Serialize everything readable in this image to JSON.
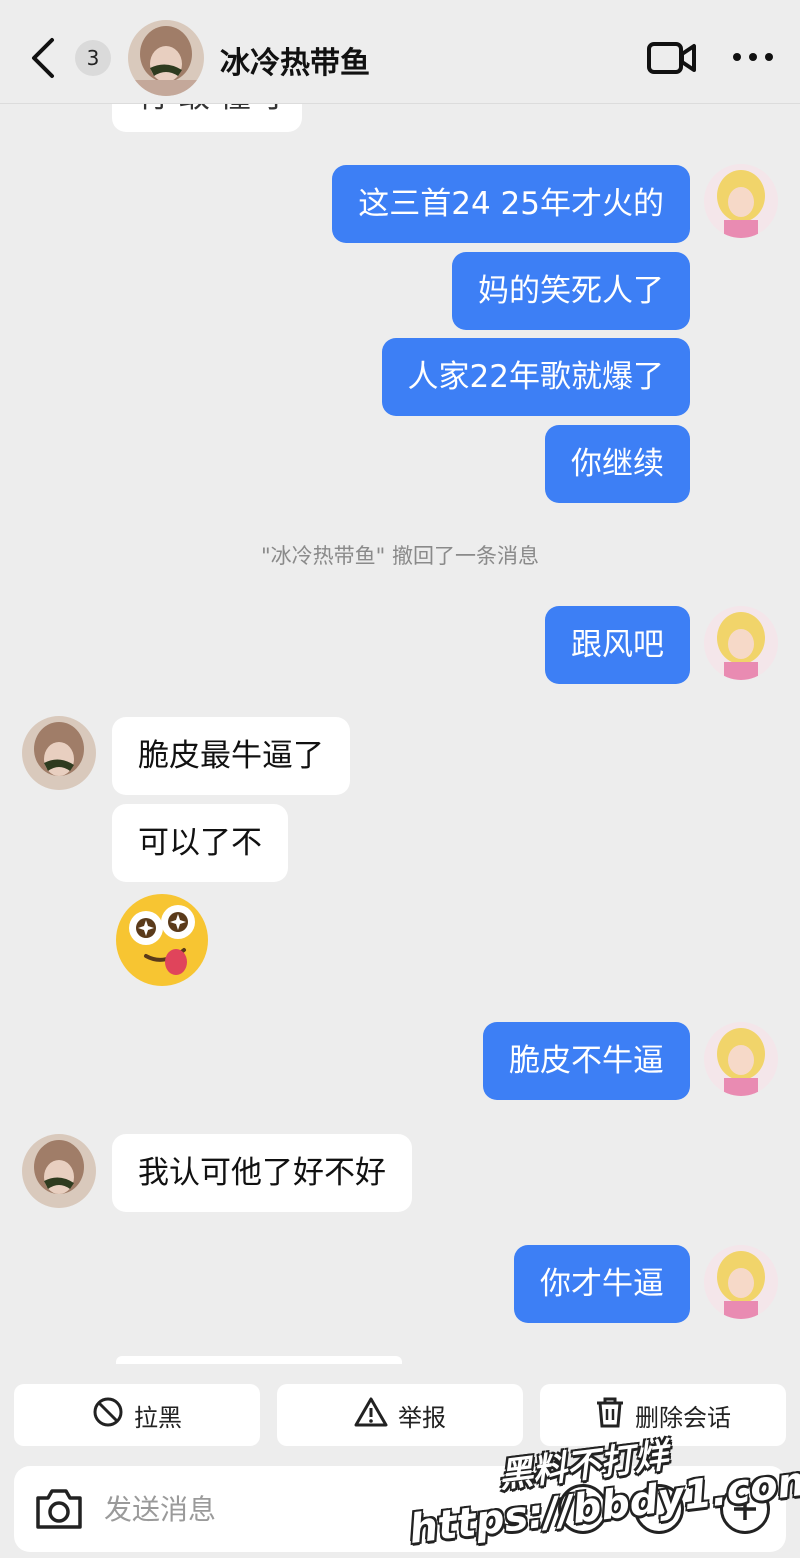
{
  "header": {
    "unread_count": "3",
    "title": "冰冷热带鱼"
  },
  "partial_top_message": "行 敢 懂 了",
  "messages": [
    {
      "side": "out",
      "text": "这三首24 25年才火的"
    },
    {
      "side": "out",
      "text": "妈的笑死人了"
    },
    {
      "side": "out",
      "text": "人家22年歌就爆了"
    },
    {
      "side": "out",
      "text": "你继续"
    },
    {
      "side": "out",
      "text": "跟风吧"
    },
    {
      "side": "in",
      "text": "脆皮最牛逼了"
    },
    {
      "side": "in",
      "text": "可以了不"
    },
    {
      "side": "out",
      "text": "脆皮不牛逼"
    },
    {
      "side": "in",
      "text": "我认可他了好不好"
    },
    {
      "side": "out",
      "text": "你才牛逼"
    }
  ],
  "system_note": "\"冰冷热带鱼\" 撤回了一条消息",
  "actions": {
    "block": "拉黑",
    "report": "举报",
    "delete": "删除会话"
  },
  "input": {
    "placeholder": "发送消息"
  },
  "watermark": {
    "line1": "黑料不打烊",
    "line2": "https://bbdy1.com"
  },
  "colors": {
    "outgoing_bubble": "#3d7ff5",
    "incoming_bubble": "#ffffff",
    "background": "#ededed"
  }
}
